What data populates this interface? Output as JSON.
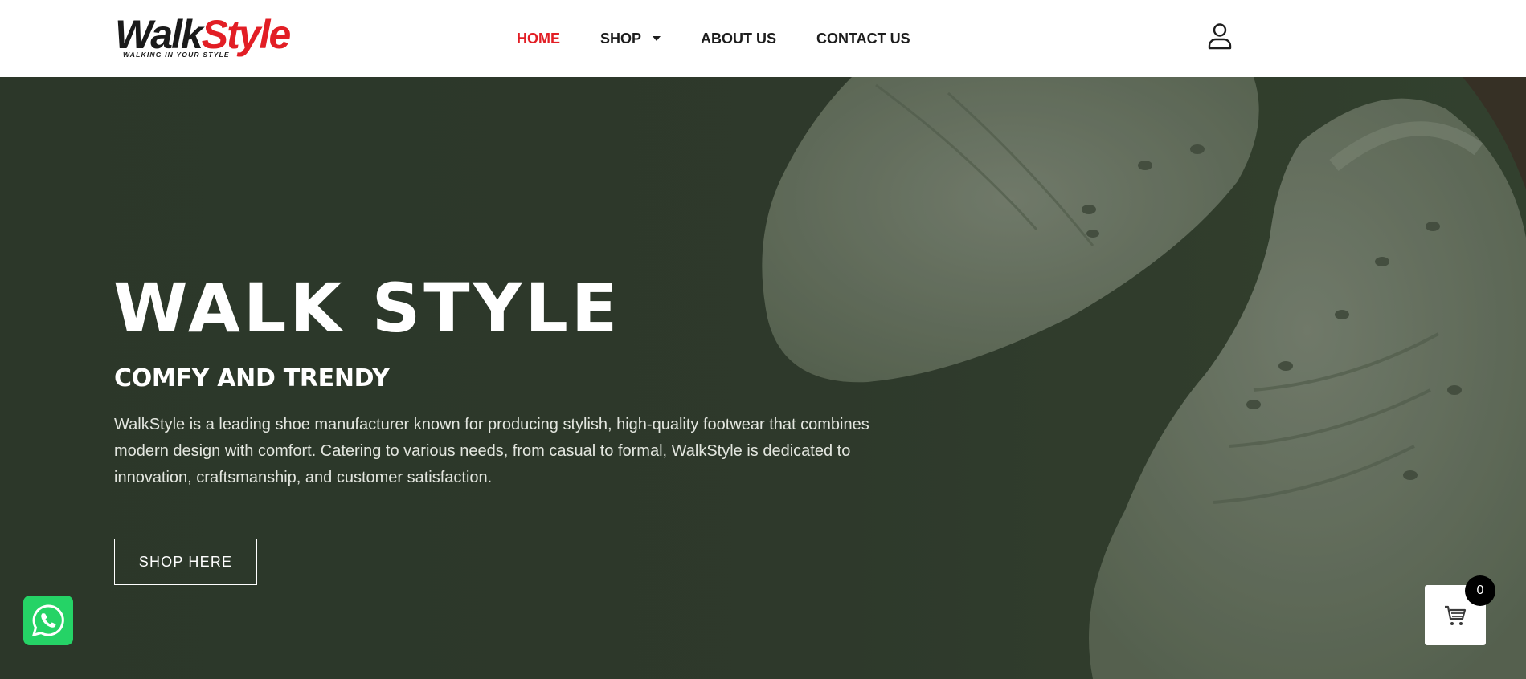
{
  "brand": {
    "logo_part1": "Walk",
    "logo_part2": "Style",
    "logo_tagline": "WALKING IN YOUR STYLE",
    "accent_color": "#e21e25"
  },
  "nav": {
    "items": [
      {
        "label": "HOME",
        "active": true
      },
      {
        "label": "SHOP",
        "has_dropdown": true
      },
      {
        "label": "ABOUT US"
      },
      {
        "label": "CONTACT US"
      }
    ],
    "account_icon": "user-icon"
  },
  "hero": {
    "title": "WALK STYLE",
    "subtitle": "COMFY AND TRENDY",
    "description": "WalkStyle is a leading shoe manufacturer known for producing stylish, high-quality footwear that combines modern design with comfort. Catering to various needs, from casual to formal, WalkStyle is dedicated to innovation, craftsmanship, and customer satisfaction.",
    "cta_label": "SHOP HERE",
    "background_color": "#2f3a2b",
    "image": "white-sneakers-illustration"
  },
  "floating": {
    "whatsapp_icon": "whatsapp-icon",
    "whatsapp_color": "#25d366",
    "cart_icon": "cart-icon",
    "cart_count": "0"
  }
}
